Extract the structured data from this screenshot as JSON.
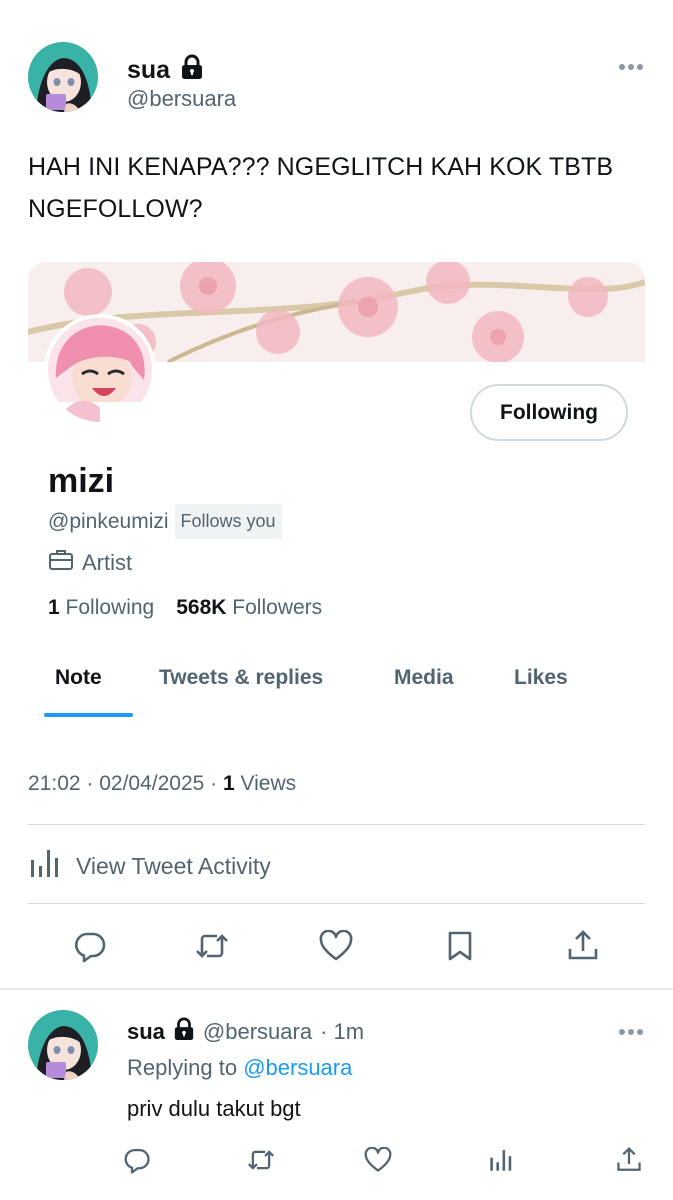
{
  "tweet": {
    "author_name": "sua",
    "author_handle": "@bersuara",
    "text": "HAH INI KENAPA??? NGEGLITCH KAH KOK TBTB NGEFOLLOW?",
    "timestamp": "21:02 · 02/04/2025 · ",
    "views_count": "1",
    "views_label": " Views",
    "activity_label": "View Tweet Activity",
    "icons": [
      "lock-icon",
      "more-icon",
      "reply-icon",
      "retweet-icon",
      "like-icon",
      "bookmark-icon",
      "share-icon",
      "activity-icon"
    ]
  },
  "profile": {
    "name": "mizi",
    "handle": "@pinkeumizi",
    "follows_you": "Follows you",
    "role": "Artist",
    "following_count": "1",
    "following_label": "Following",
    "followers_count": "568K",
    "followers_label": "Followers",
    "follow_button": "Following",
    "tabs": [
      {
        "label": "Note"
      },
      {
        "label": "Tweets & replies"
      },
      {
        "label": "Media"
      },
      {
        "label": "Likes"
      }
    ],
    "active_tab": "Note"
  },
  "reply": {
    "author_name": "sua",
    "author_handle": "@bersuara",
    "time": "· 1m",
    "replying_prefix": "Replying to ",
    "replying_to": "@bersuara",
    "text": "priv dulu takut bgt"
  },
  "colors": {
    "accent": "#1d9bf0",
    "text": "#0f1419",
    "muted": "#536471",
    "border": "#cfd9de"
  }
}
